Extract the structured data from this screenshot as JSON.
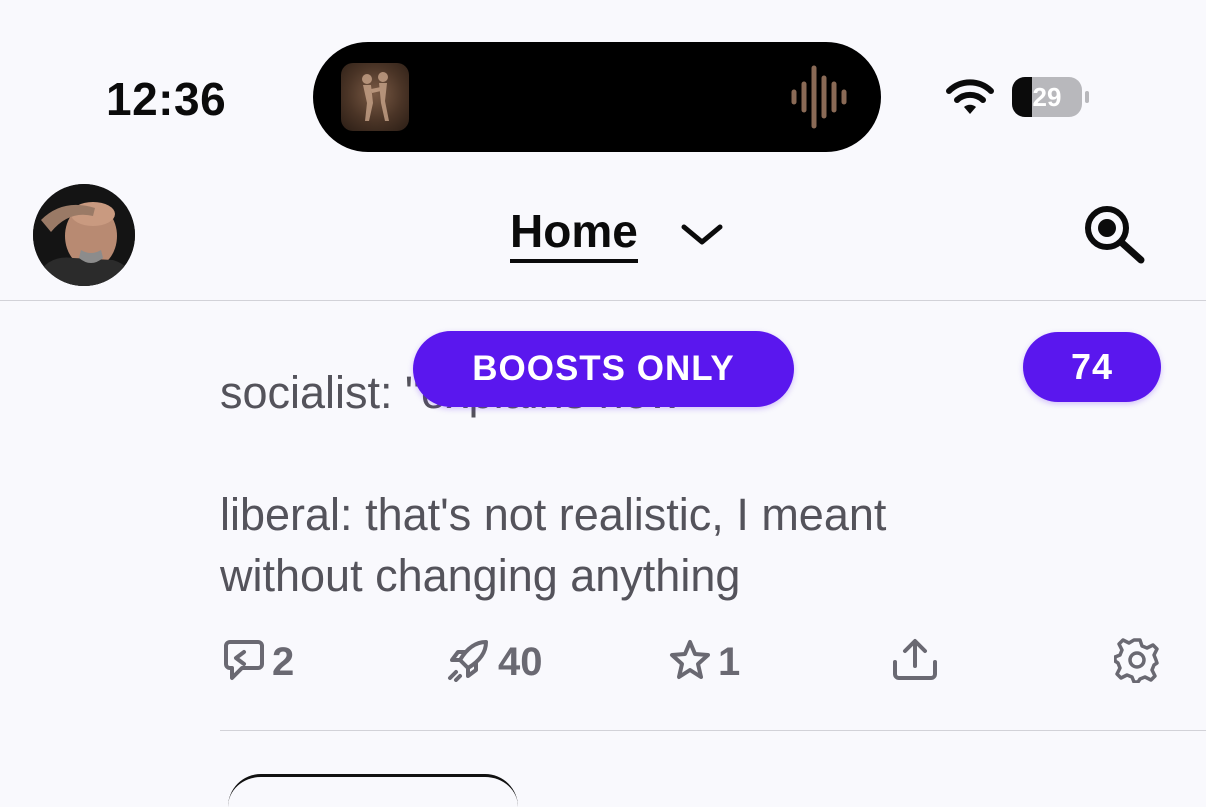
{
  "status_bar": {
    "time": "12:36",
    "battery_level": "29",
    "battery_fraction": 0.29,
    "icons": [
      "now-playing-artwork",
      "audio-waveform-icon",
      "wifi-icon",
      "battery-icon"
    ]
  },
  "header": {
    "title": "Home",
    "icons": [
      "avatar",
      "chevron-down-icon",
      "search-icon"
    ]
  },
  "overlays": {
    "boosts_only_label": "BOOSTS ONLY",
    "unread_count": "74"
  },
  "post": {
    "line_partial": "socialist: \"explains how\"",
    "paragraph_line_1": "liberal:  that's not realistic, I meant",
    "paragraph_line_2": "without changing anything",
    "actions": {
      "replies": "2",
      "boosts": "40",
      "favourites": "1"
    }
  },
  "colors": {
    "accent": "#5a17ee",
    "background": "#f9f9fd",
    "text": "#54535b",
    "action_icon": "#6a6972"
  }
}
